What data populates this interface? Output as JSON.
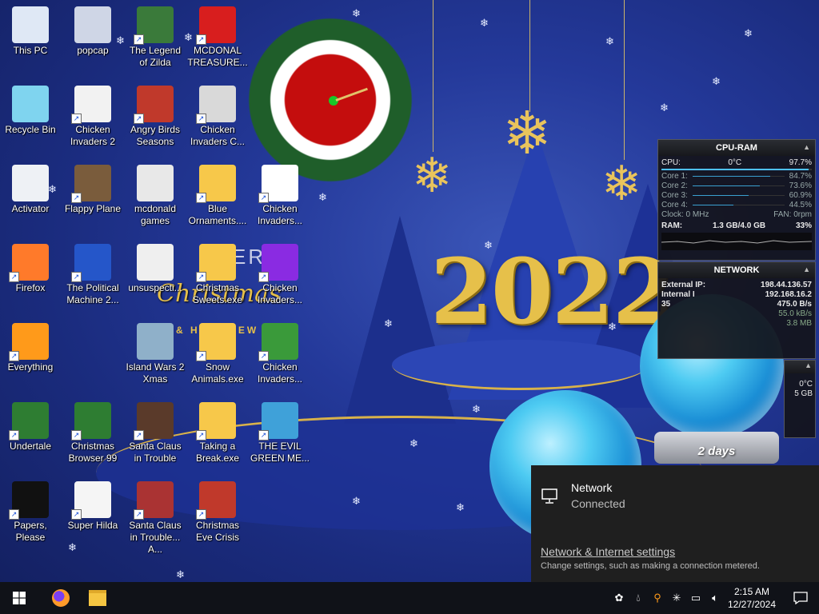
{
  "desktop_icons": [
    {
      "label": "This PC",
      "shortcut": false
    },
    {
      "label": "popcap",
      "shortcut": false
    },
    {
      "label": "The Legend of Zilda",
      "shortcut": true
    },
    {
      "label": "MCDONAL TREASURE...",
      "shortcut": true
    },
    {
      "label": "Recycle Bin",
      "shortcut": false
    },
    {
      "label": "Chicken Invaders 2",
      "shortcut": true
    },
    {
      "label": "Angry Birds Seasons",
      "shortcut": true
    },
    {
      "label": "Chicken Invaders C...",
      "shortcut": true
    },
    {
      "label": "Activator",
      "shortcut": false
    },
    {
      "label": "Flappy Plane",
      "shortcut": true
    },
    {
      "label": "mcdonald games",
      "shortcut": false
    },
    {
      "label": "Blue Ornaments....",
      "shortcut": true
    },
    {
      "label": "Chicken Invaders...",
      "shortcut": true
    },
    {
      "label": "Firefox",
      "shortcut": true
    },
    {
      "label": "The Political Machine 2...",
      "shortcut": true
    },
    {
      "label": "unsuspecti...",
      "shortcut": false
    },
    {
      "label": "Christmas Sweets.exe",
      "shortcut": true
    },
    {
      "label": "Chicken Invaders...",
      "shortcut": true
    },
    {
      "label": "Everything",
      "shortcut": true
    },
    {
      "label": "Island Wars 2 Xmas",
      "shortcut": false
    },
    {
      "label": "Snow Animals.exe",
      "shortcut": true
    },
    {
      "label": "Chicken Invaders...",
      "shortcut": true
    },
    {
      "label": "Undertale",
      "shortcut": true
    },
    {
      "label": "Christmas Browser 99",
      "shortcut": true
    },
    {
      "label": "Santa Claus in Trouble",
      "shortcut": true
    },
    {
      "label": "Taking a Break.exe",
      "shortcut": true
    },
    {
      "label": "THE EVIL GREEN ME...",
      "shortcut": true
    },
    {
      "label": "Papers, Please",
      "shortcut": true
    },
    {
      "label": "Super Hilda",
      "shortcut": true
    },
    {
      "label": "Santa Claus in Trouble... A...",
      "shortcut": true
    },
    {
      "label": "Christmas Eve Crisis",
      "shortcut": true
    }
  ],
  "wallpaper": {
    "year": "2022",
    "letters": "ER",
    "script": "Christmas",
    "sub": "& HA    NEW",
    "globe_label": "2 days"
  },
  "cpu_gadget": {
    "title": "CPU-RAM",
    "cpu_label": "CPU:",
    "cpu_temp": "0°C",
    "cpu_pct": "97.7%",
    "cores": [
      {
        "label": "Core 1:",
        "value": "84.7%",
        "level": 0.847
      },
      {
        "label": "Core 2:",
        "value": "73.6%",
        "level": 0.736
      },
      {
        "label": "Core 3:",
        "value": "60.9%",
        "level": 0.609
      },
      {
        "label": "Core 4:",
        "value": "44.5%",
        "level": 0.445
      }
    ],
    "clock": "Clock: 0 MHz",
    "fan": "FAN: 0rpm",
    "ram_label": "RAM:",
    "ram_value": "1.3 GB/4.0 GB",
    "ram_pct": "33%"
  },
  "net_gadget": {
    "title": "NETWORK",
    "external_label": "External IP:",
    "external_ip": "198.44.136.57",
    "internal_label": "Internal I",
    "internal_ip": "192.168.16.2",
    "rate_prefix": "35",
    "rate1": "475.0 B/s",
    "rate2": "55.0 kB/s",
    "total": "3.8 MB",
    "temp": "0°C",
    "size": "5 GB"
  },
  "flyout": {
    "network_title": "Network",
    "network_status": "Connected",
    "settings_link": "Network & Internet settings",
    "hint": "Change settings, such as making a connection metered."
  },
  "taskbar": {
    "time": "2:15 AM",
    "date": "12/27/2024"
  },
  "colors": {
    "taskbar": "#101218",
    "flyout": "#1f1f1f",
    "wallpaper": "#24399a",
    "gold": "#e6c04a"
  }
}
